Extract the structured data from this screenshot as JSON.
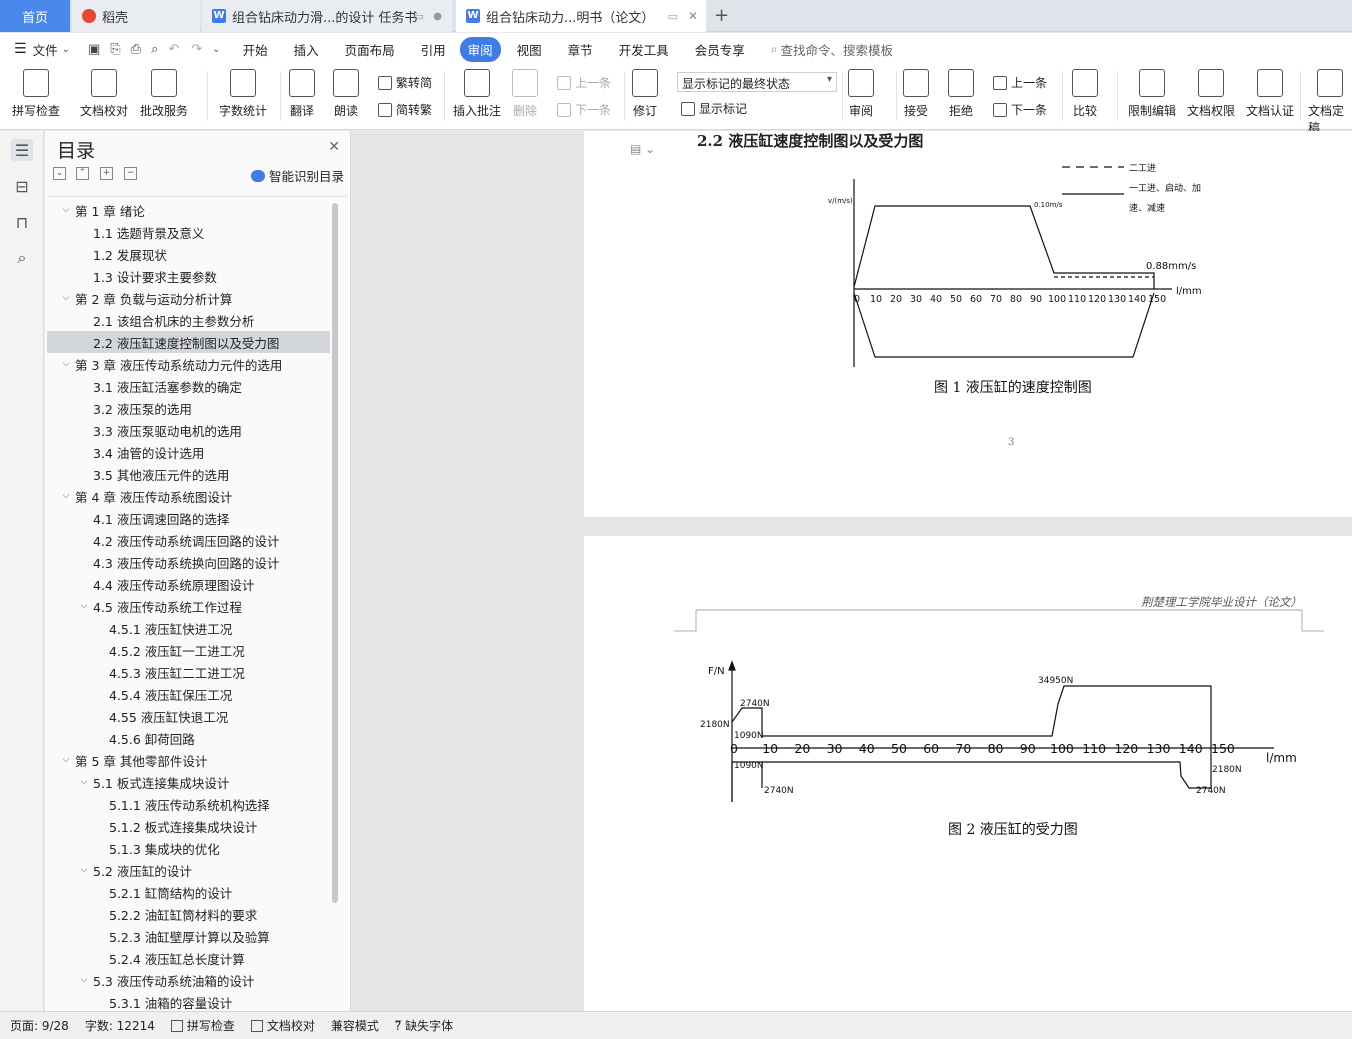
{
  "tabs": {
    "home": "首页",
    "t1": "稻壳",
    "t2": "组合钻床动力滑...的设计 任务书",
    "t3": "组合钻床动力...明书（论文）"
  },
  "menu": {
    "file": "文件",
    "items": [
      "开始",
      "插入",
      "页面布局",
      "引用",
      "审阅",
      "视图",
      "章节",
      "开发工具",
      "会员专享"
    ],
    "search": "查找命令、搜索模板"
  },
  "ribbon": {
    "spell": "拼写检查",
    "proof": "文档校对",
    "batch": "批改服务",
    "wordcount": "字数统计",
    "translate": "翻译",
    "read": "朗读",
    "t2s": "繁转简",
    "s2t": "简转繁",
    "insert_comment": "插入批注",
    "delete": "删除",
    "prev_comment": "上一条",
    "next_comment": "下一条",
    "revise": "修订",
    "markup_state": "显示标记的最终状态",
    "show_markup": "显示标记",
    "review": "审阅",
    "accept": "接受",
    "reject": "拒绝",
    "prev_change": "上一条",
    "next_change": "下一条",
    "compare": "比较",
    "restrict": "限制编辑",
    "doc_perm": "文档权限",
    "doc_cert": "文档认证",
    "doc_final": "文档定稿"
  },
  "toc": {
    "title": "目录",
    "smart": "智能识别目录",
    "items": [
      {
        "label": "第 1 章  绪论",
        "level": 0,
        "chev": "⌄"
      },
      {
        "label": "1.1  选题背景及意义",
        "level": 1
      },
      {
        "label": "1.2  发展现状",
        "level": 1
      },
      {
        "label": "1.3  设计要求主要参数",
        "level": 1
      },
      {
        "label": "第 2 章  负载与运动分析计算",
        "level": 0,
        "chev": "⌄"
      },
      {
        "label": "2.1  该组合机床的主参数分析",
        "level": 1
      },
      {
        "label": "2.2  液压缸速度控制图以及受力图",
        "level": 1,
        "selected": true
      },
      {
        "label": "第 3 章  液压传动系统动力元件的选用",
        "level": 0,
        "chev": "⌄"
      },
      {
        "label": "3.1  液压缸活塞参数的确定",
        "level": 1
      },
      {
        "label": "3.2  液压泵的选用",
        "level": 1
      },
      {
        "label": "3.3  液压泵驱动电机的选用",
        "level": 1
      },
      {
        "label": "3.4  油管的设计选用",
        "level": 1
      },
      {
        "label": "3.5  其他液压元件的选用",
        "level": 1
      },
      {
        "label": "第 4 章  液压传动系统图设计",
        "level": 0,
        "chev": "⌄"
      },
      {
        "label": "4.1  液压调速回路的选择",
        "level": 1
      },
      {
        "label": "4.2  液压传动系统调压回路的设计",
        "level": 1
      },
      {
        "label": "4.3  液压传动系统换向回路的设计",
        "level": 1
      },
      {
        "label": "4.4  液压传动系统原理图设计",
        "level": 1
      },
      {
        "label": "4.5  液压传动系统工作过程",
        "level": 1,
        "chev": "⌄"
      },
      {
        "label": "4.5.1  液压缸快进工况",
        "level": 2
      },
      {
        "label": "4.5.2  液压缸一工进工况",
        "level": 2
      },
      {
        "label": "4.5.3 液压缸二工进工况",
        "level": 2
      },
      {
        "label": "4.5.4  液压缸保压工况",
        "level": 2
      },
      {
        "label": "4.55  液压缸快退工况",
        "level": 2
      },
      {
        "label": "4.5.6  卸荷回路",
        "level": 2
      },
      {
        "label": "第 5 章  其他零部件设计",
        "level": 0,
        "chev": "⌄"
      },
      {
        "label": "5.1  板式连接集成块设计",
        "level": 1,
        "chev": "⌄"
      },
      {
        "label": "5.1.1  液压传动系统机构选择",
        "level": 2
      },
      {
        "label": "5.1.2  板式连接集成块设计",
        "level": 2
      },
      {
        "label": "5.1.3  集成块的优化",
        "level": 2
      },
      {
        "label": "5.2  液压缸的设计",
        "level": 1,
        "chev": "⌄"
      },
      {
        "label": "5.2.1  缸筒结构的设计",
        "level": 2
      },
      {
        "label": "5.2.2  油缸缸筒材料的要求",
        "level": 2
      },
      {
        "label": "5.2.3  油缸壁厚计算以及验算",
        "level": 2
      },
      {
        "label": "5.2.4  液压缸总长度计算",
        "level": 2
      },
      {
        "label": "5.3  液压传动系统油箱的设计",
        "level": 1,
        "chev": "⌄"
      },
      {
        "label": "5.3.1  油箱的容量设计",
        "level": 2
      }
    ]
  },
  "doc": {
    "heading": "2.2  液压缸速度控制图以及受力图",
    "fig1_caption": "图 1  液压缸的速度控制图",
    "page_number": "3",
    "header": "荆楚理工学院毕业设计（论文）",
    "fig2_caption": "图 2  液压缸的受力图",
    "fig1": {
      "ylabel": "v/(m/s)",
      "xlabel": "l/mm",
      "speed_fast": "0.10m/s",
      "speed_slow": "0.88mm/s",
      "legend1": "二工进",
      "legend2a": "一工进、启动、加",
      "legend2b": "速、减速",
      "ticks": [
        "0",
        "10",
        "20",
        "30",
        "40",
        "50",
        "60",
        "70",
        "80",
        "90",
        "100",
        "110",
        "120",
        "130",
        "140",
        "150"
      ]
    },
    "fig2": {
      "ylabel": "F/N",
      "xlabel": "l/mm",
      "ticks": [
        "0",
        "10",
        "20",
        "30",
        "40",
        "50",
        "60",
        "70",
        "80",
        "90",
        "100",
        "110",
        "120",
        "130",
        "140",
        "150"
      ],
      "f_top": "34950N",
      "f_2740": "2740N",
      "f_2180": "2180N",
      "f_1090": "1090N",
      "f_1090b": "1090N",
      "f_2740b": "2740N",
      "f_2180b": "2180N",
      "f_2740c": "2740N"
    }
  },
  "status": {
    "page": "页面: 9/28",
    "words": "字数: 12214",
    "spell": "拼写检查",
    "proof": "文档校对",
    "compat": "兼容模式",
    "missing_font": "缺失字体"
  }
}
